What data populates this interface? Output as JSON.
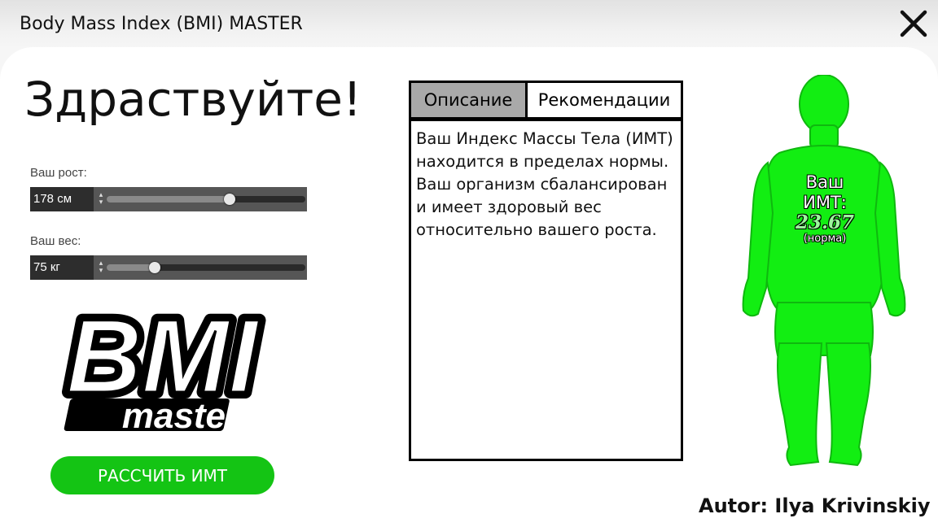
{
  "window": {
    "title": "Body Mass Index (BMI) MASTER",
    "close_icon": "close-icon"
  },
  "greeting": "Здраствуйте!",
  "height_field": {
    "label": "Ваш рост:",
    "value": "178 см",
    "slider_fraction": 0.62
  },
  "weight_field": {
    "label": "Ваш вес:",
    "value": "75 кг",
    "slider_fraction": 0.24
  },
  "logo": {
    "word1": "BMI",
    "word2": "master"
  },
  "calculate_button": "РАССЧИТЬ ИМТ",
  "tabs": [
    {
      "label": "Описание",
      "active": true
    },
    {
      "label": "Рекомендации",
      "active": false
    }
  ],
  "description_text": "Ваш Индекс Массы Тела (ИМТ) находится в пределах нормы. Ваш организм сбалансирован и имеет здоровый вес относительно вашего роста.",
  "bmi": {
    "label_line1": "Ваш",
    "label_line2": "ИМТ:",
    "value": "23.67",
    "status": "(норма)",
    "figure_color": "#12ee12"
  },
  "author": "Autor: Ilya Krivinskiy",
  "colors": {
    "accent": "#14c414",
    "figure": "#12ee12",
    "tab_active": "#a9a9a9"
  }
}
